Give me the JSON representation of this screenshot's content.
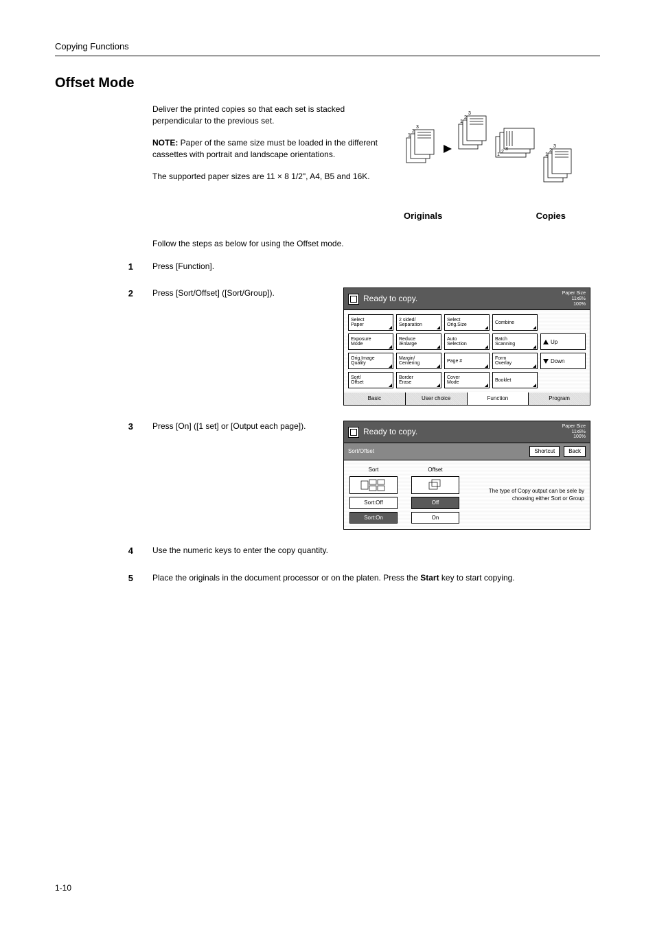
{
  "header": {
    "section": "Copying Functions"
  },
  "title": "Offset Mode",
  "intro": {
    "p1": "Deliver the printed copies so that each set is stacked perpendicular to the previous set.",
    "note_label": "NOTE:",
    "note_body": " Paper of the same size must be loaded in the different cassettes with portrait and landscape orientations.",
    "p3": "The supported paper sizes are 11 × 8 1/2\", A4, B5 and 16K."
  },
  "diagram": {
    "originals": "Originals",
    "copies": "Copies",
    "nums": [
      "1",
      "2",
      "3"
    ]
  },
  "follow": "Follow the steps as below for using the Offset mode.",
  "steps": {
    "s1": {
      "num": "1",
      "text": "Press [Function]."
    },
    "s2": {
      "num": "2",
      "text": "Press [Sort/Offset] ([Sort/Group])."
    },
    "s3": {
      "num": "3",
      "text": "Press [On] ([1 set] or [Output each page])."
    },
    "s4": {
      "num": "4",
      "text": "Use the numeric keys to enter the copy quantity."
    },
    "s5": {
      "num": "5",
      "text_a": "Place the originals in the document processor or on the platen. Press the ",
      "start": "Start",
      "text_b": " key to start copying."
    }
  },
  "panel1": {
    "title": "Ready to copy.",
    "paper_size_label": "Paper Size",
    "paper_size": "11x8½",
    "zoom": "100%",
    "grid": [
      [
        "Select\nPaper",
        "2 sided/\nSeparation",
        "Select\nOrig.Size",
        "Combine",
        ""
      ],
      [
        "Exposure\nMode",
        "Reduce\n/Enlarge",
        "Auto\nSelection",
        "Batch\nScanning",
        "Up"
      ],
      [
        "Orig.Image\nQuality",
        "Margin/\nCentering",
        "Page #",
        "Form\nOverlay",
        "Down"
      ],
      [
        "Sort/\nOffset",
        "Border\nErase",
        "Cover\nMode",
        "Booklet",
        ""
      ]
    ],
    "tabs": [
      "Basic",
      "User choice",
      "Function",
      "Program"
    ]
  },
  "panel2": {
    "title": "Ready to copy.",
    "paper_size_label": "Paper Size",
    "paper_size": "11x8½",
    "zoom": "100%",
    "breadcrumb": "Sort/Offset",
    "shortcut": "Shortcut",
    "back": "Back",
    "col1_label": "Sort",
    "col2_label": "Offset",
    "col1_opts": [
      "Sort:Off",
      "Sort:On"
    ],
    "col2_opts": [
      "Off",
      "On"
    ],
    "desc": "The type of Copy output can be sele\nby choosing either Sort or Group"
  },
  "footer": "1-10"
}
